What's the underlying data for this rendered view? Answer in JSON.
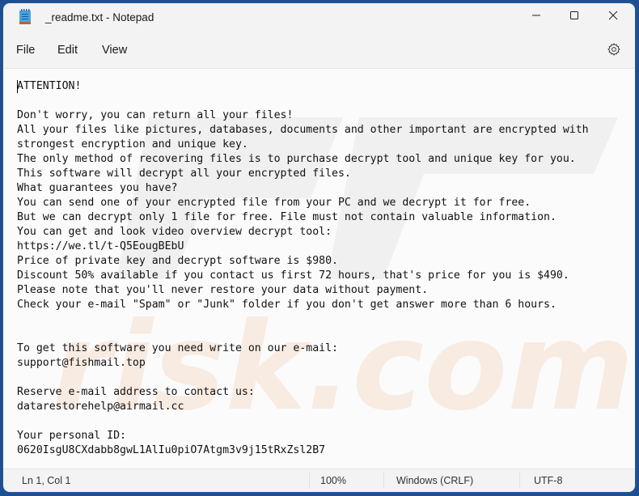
{
  "window": {
    "title": "_readme.txt - Notepad",
    "app_icon": "notepad-icon",
    "caption_buttons": {
      "minimize": "minimize-icon",
      "maximize": "maximize-icon",
      "close": "close-icon"
    }
  },
  "menu": {
    "items": [
      {
        "label": "File"
      },
      {
        "label": "Edit"
      },
      {
        "label": "View"
      }
    ],
    "settings_icon": "gear-icon"
  },
  "editor": {
    "lines": [
      "ATTENTION!",
      "",
      "Don't worry, you can return all your files!",
      "All your files like pictures, databases, documents and other important are encrypted with",
      "strongest encryption and unique key.",
      "The only method of recovering files is to purchase decrypt tool and unique key for you.",
      "This software will decrypt all your encrypted files.",
      "What guarantees you have?",
      "You can send one of your encrypted file from your PC and we decrypt it for free.",
      "But we can decrypt only 1 file for free. File must not contain valuable information.",
      "You can get and look video overview decrypt tool:",
      "https://we.tl/t-Q5EougBEbU",
      "Price of private key and decrypt software is $980.",
      "Discount 50% available if you contact us first 72 hours, that's price for you is $490.",
      "Please note that you'll never restore your data without payment.",
      "Check your e-mail \"Spam\" or \"Junk\" folder if you don't get answer more than 6 hours.",
      "",
      "",
      "To get this software you need write on our e-mail:",
      "support@fishmail.top",
      "",
      "Reserve e-mail address to contact us:",
      "datarestorehelp@airmail.cc",
      "",
      "Your personal ID:",
      "0620IsgU8CXdabb8gwL1AlIu0piO7Atgm3v9j15tRxZsl2B7"
    ],
    "watermark_text": "risk.com"
  },
  "status": {
    "position": "Ln 1, Col 1",
    "zoom": "100%",
    "line_ending": "Windows (CRLF)",
    "encoding": "UTF-8"
  }
}
